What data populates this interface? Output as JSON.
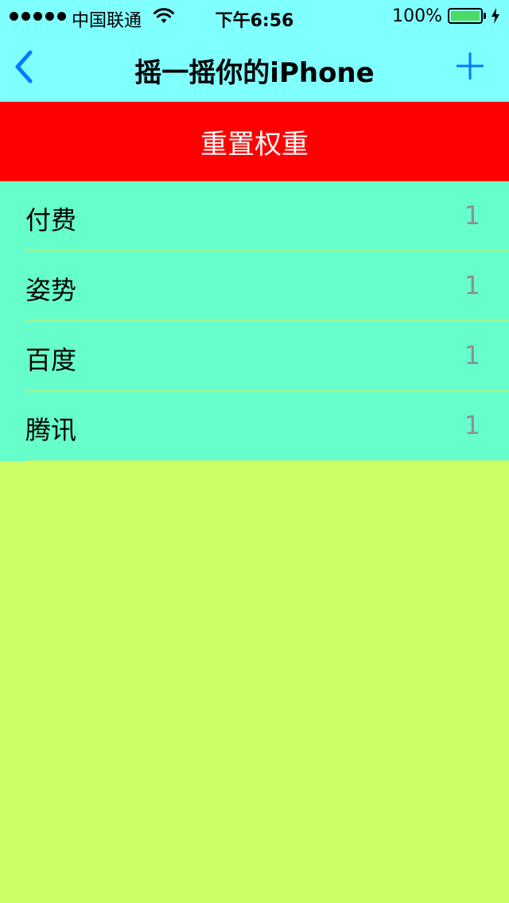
{
  "status_bar": {
    "carrier": "中国联通",
    "time": "下午6:56",
    "battery_percent": "100%",
    "battery_level": 1.0,
    "signal_bars": 5
  },
  "nav": {
    "title": "摇一摇你的iPhone",
    "back_icon": "chevron-left-icon",
    "add_icon": "plus-icon",
    "tint_color": "#007AFF",
    "background_color": "#80FFFF"
  },
  "reset_button": {
    "label": "重置权重",
    "background_color": "#FF0000",
    "text_color": "#FFFFFF"
  },
  "table": {
    "background_color": "#66FFCC",
    "rows": [
      {
        "label": "付费",
        "value": "1"
      },
      {
        "label": "姿势",
        "value": "1"
      },
      {
        "label": "百度",
        "value": "1"
      },
      {
        "label": "腾讯",
        "value": "1"
      }
    ]
  },
  "page_background_color": "#CCFF66"
}
